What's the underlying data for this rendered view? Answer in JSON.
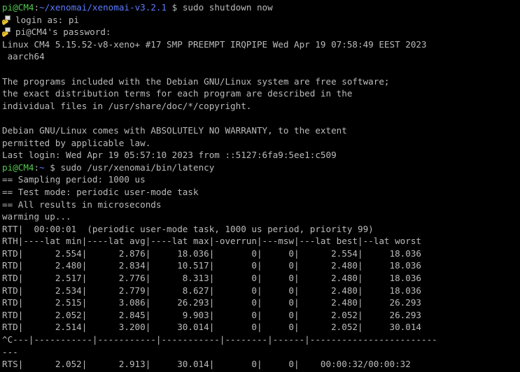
{
  "terminal": {
    "colors": {
      "background": "#000000",
      "text": "#bbbbbb",
      "user": "#4ecb4e",
      "path": "#5c7cff"
    },
    "prompt1": {
      "user": "pi@CM4",
      "sep": ":",
      "path": "~/xenomai/xenomai-v3.2.1",
      "symbol": " $ ",
      "command": "sudo shutdown now"
    },
    "login_as": "login as: pi",
    "password_prompt": "pi@CM4's password:",
    "login_icon": "putty-key-icon",
    "lines_a": [
      "Linux CM4 5.15.52-v8-xeno+ #17 SMP PREEMPT IRQPIPE Wed Apr 19 07:58:49 EEST 2023",
      " aarch64",
      "",
      "The programs included with the Debian GNU/Linux system are free software;",
      "the exact distribution terms for each program are described in the",
      "individual files in /usr/share/doc/*/copyright.",
      "",
      "Debian GNU/Linux comes with ABSOLUTELY NO WARRANTY, to the extent",
      "permitted by applicable law.",
      "Last login: Wed Apr 19 05:57:10 2023 from ::5127:6fa9:5ee1:c509"
    ],
    "prompt2": {
      "user": "pi@CM4",
      "sep": ":",
      "path": "~",
      "symbol": " $ ",
      "command": "sudo /usr/xenomai/bin/latency"
    },
    "lines_b": [
      "== Sampling period: 1000 us",
      "== Test mode: periodic user-mode task",
      "== All results in microseconds",
      "warming up...",
      "RTT|  00:00:01  (periodic user-mode task, 1000 us period, priority 99)",
      "RTH|----lat min|----lat avg|----lat max|-overrun|---msw|---lat best|--lat worst",
      "RTD|      2.554|      2.876|     18.036|       0|     0|      2.554|     18.036",
      "RTD|      2.480|      2.834|     10.517|       0|     0|      2.480|     18.036",
      "RTD|      2.517|      2.776|      8.313|       0|     0|      2.480|     18.036",
      "RTD|      2.534|      2.779|      8.627|       0|     0|      2.480|     18.036",
      "RTD|      2.515|      3.086|     26.293|       0|     0|      2.480|     26.293",
      "RTD|      2.052|      2.845|      9.903|       0|     0|      2.052|     26.293",
      "RTD|      2.514|      3.200|     30.014|       0|     0|      2.052|     30.014",
      "^C---|-----------|-----------|-----------|--------|------|------------------------",
      "---",
      "RTS|      2.052|      2.913|     30.014|       0|     0|    00:00:32/00:00:32"
    ]
  }
}
